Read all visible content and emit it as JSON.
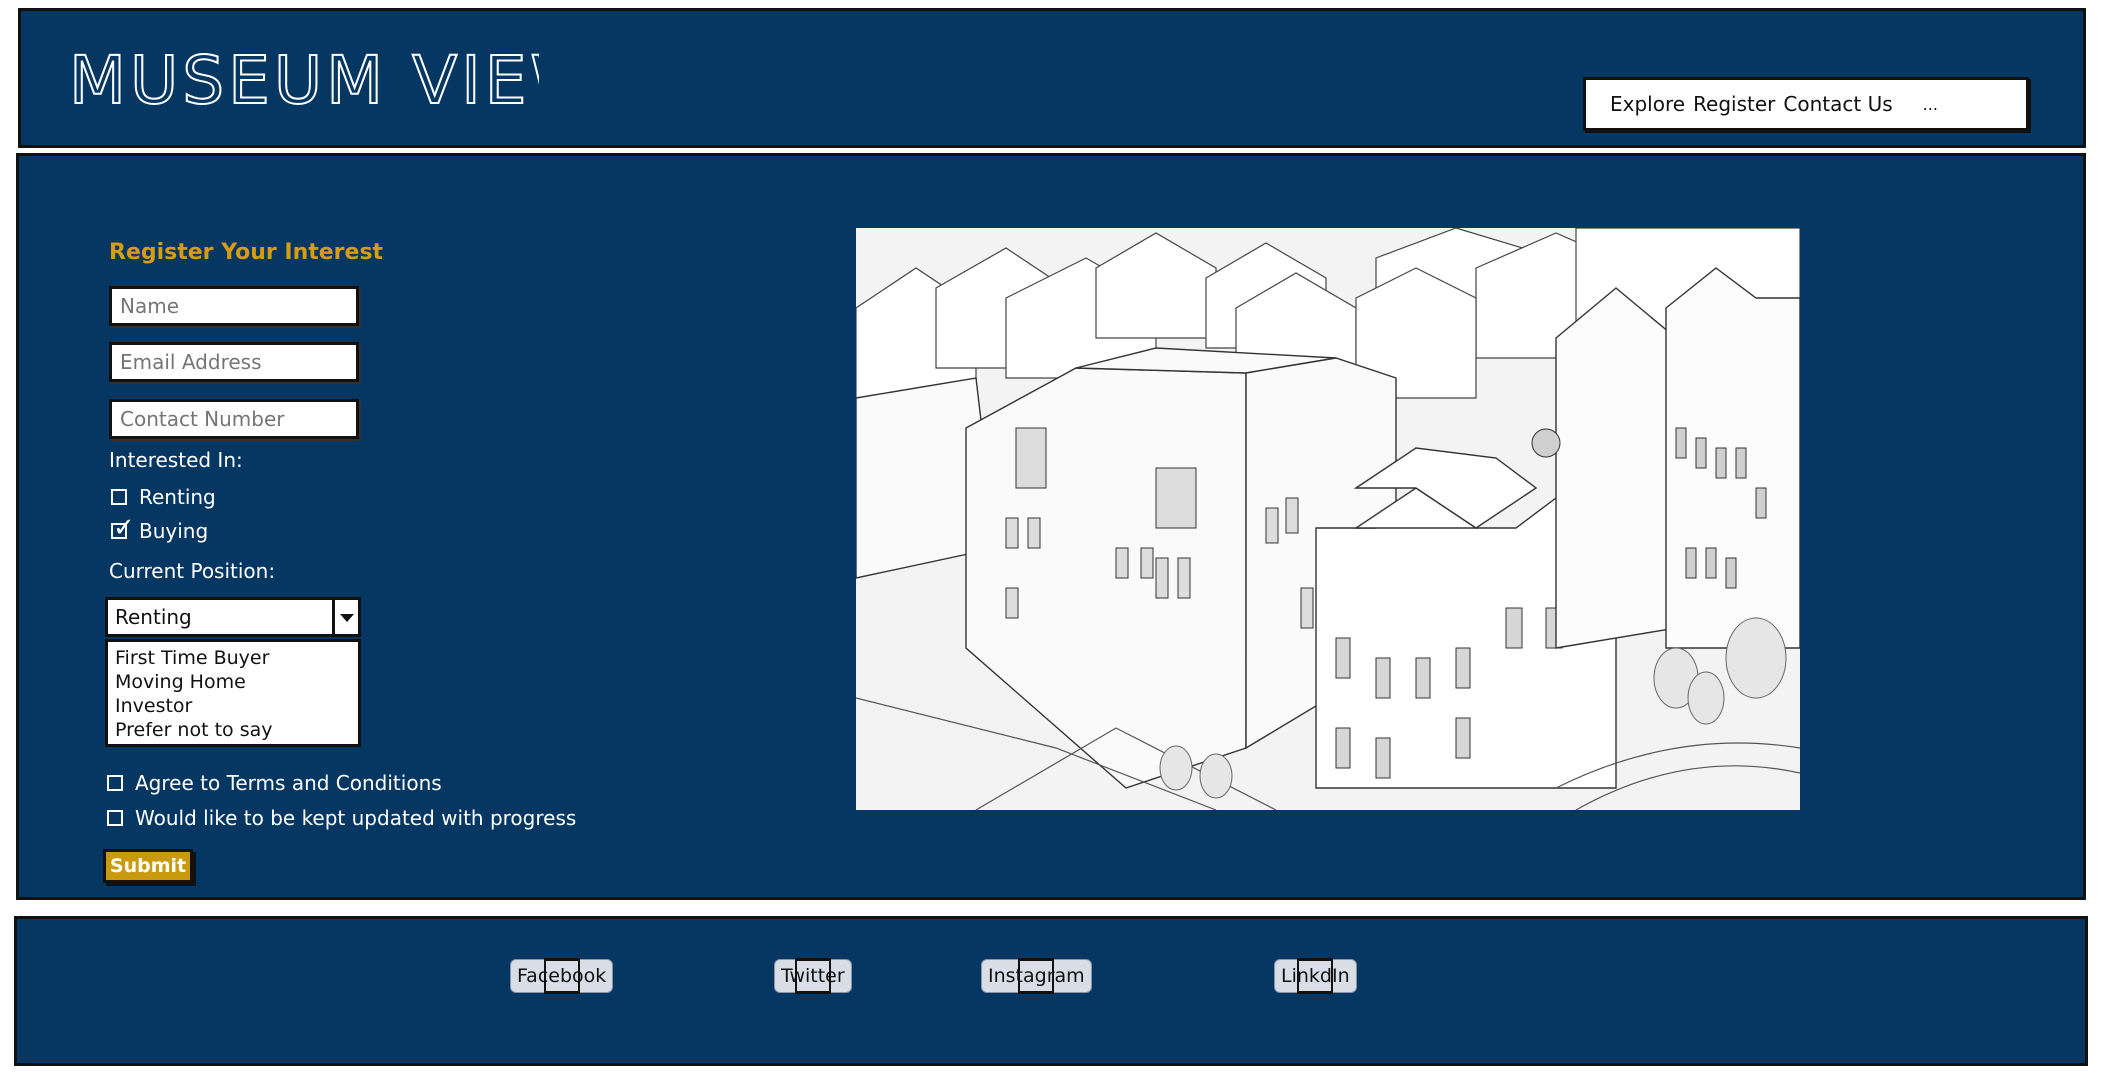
{
  "header": {
    "logo_text": "MUSEUM VIEW",
    "nav": {
      "items": [
        "Explore",
        "Register",
        "Contact Us"
      ],
      "more": "..."
    }
  },
  "form": {
    "title": "Register Your Interest",
    "fields": {
      "name": "Name",
      "email": "Email Address",
      "phone": "Contact Number"
    },
    "interested_label": "Interested In:",
    "options": [
      {
        "label": "Renting",
        "checked": false
      },
      {
        "label": "Buying",
        "checked": true
      }
    ],
    "position_label": "Current Position:",
    "position_select": {
      "selected": "Renting",
      "options": [
        "First Time Buyer",
        "Moving Home",
        "Investor",
        "Prefer not to say"
      ]
    },
    "agreements": [
      {
        "label": "Agree to Terms and Conditions",
        "checked": false
      },
      {
        "label": "Would like to be kept updated with progress",
        "checked": false
      }
    ],
    "submit_label": "Submit"
  },
  "hero_image": {
    "icon": "building-render-image"
  },
  "footer": {
    "links": [
      "Facebook",
      "Twitter",
      "Instagram",
      "LinkdIn"
    ]
  },
  "colors": {
    "panel": "#063763",
    "accent": "#d89b14",
    "submit": "#c99a0e"
  }
}
